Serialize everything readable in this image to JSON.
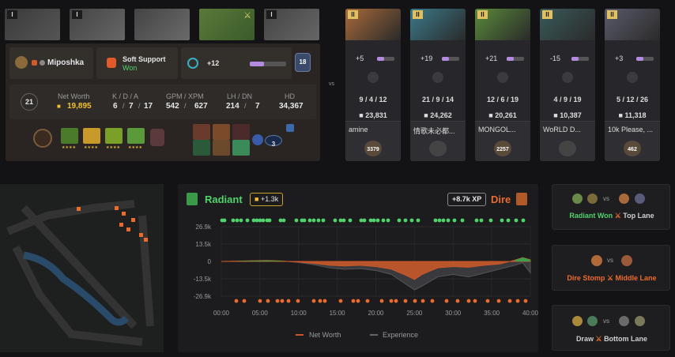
{
  "top_heroes": [
    {
      "level": "I",
      "color": "#4a4a4a"
    },
    {
      "level": "I",
      "color": "#505050"
    },
    {
      "level": "",
      "color": "#555555"
    },
    {
      "level": "",
      "color": "#6a8a3a",
      "selected": true
    },
    {
      "level": "I",
      "color": "#4a4a4a"
    }
  ],
  "player": {
    "name": "Miposhka",
    "role": "Soft Support",
    "result": "Won",
    "xp_change": "+12",
    "rank_badge": "18",
    "level": "21",
    "net_worth_label": "Net Worth",
    "net_worth": "19,895",
    "kda_label": "K / D / A",
    "kills": "6",
    "deaths": "7",
    "assists": "17",
    "gpm_xpm_label": "GPM / XPM",
    "gpm": "542",
    "xpm": "627",
    "lh_dn_label": "LH / DN",
    "lh": "214",
    "dn": "7",
    "hd_label": "HD",
    "hd": "34,367",
    "backpack_count": "3"
  },
  "vs_label": "vs",
  "opponents": [
    {
      "level": "II",
      "change": "+5",
      "k": "9",
      "d": "4",
      "a": "12",
      "net_worth": "23,831",
      "name": "amine",
      "rank": "3379",
      "color": "#a86a3a"
    },
    {
      "level": "II",
      "change": "+19",
      "k": "21",
      "d": "9",
      "a": "14",
      "net_worth": "24,262",
      "name": "情歌未必都...",
      "rank": "",
      "color": "#3a7a8a"
    },
    {
      "level": "II",
      "change": "+21",
      "k": "12",
      "d": "6",
      "a": "19",
      "net_worth": "20,261",
      "name": "MONGOL...",
      "rank": "2257",
      "color": "#5a8a3a"
    },
    {
      "level": "II",
      "change": "-15",
      "k": "4",
      "d": "9",
      "a": "19",
      "net_worth": "10,387",
      "name": "WoRLD D...",
      "rank": "",
      "color": "#3a5a5a"
    },
    {
      "level": "II",
      "change": "+3",
      "k": "5",
      "d": "12",
      "a": "26",
      "net_worth": "11,318",
      "name": "10k Please, ...",
      "rank": "462",
      "color": "#5a5a6a"
    }
  ],
  "graph": {
    "radiant_label": "Radiant",
    "radiant_badge": "+1.3k",
    "dire_label": "Dire",
    "dire_badge": "+8.7k XP",
    "y_ticks": [
      "26.9k",
      "13.5k",
      "0",
      "-13.5k",
      "-26.9k"
    ],
    "x_ticks": [
      "00:00",
      "05:00",
      "10:00",
      "15:00",
      "20:00",
      "25:00",
      "30:00",
      "35:00",
      "40:00"
    ],
    "legend_net_worth": "Net Worth",
    "legend_experience": "Experience",
    "colors": {
      "radiant": "#4fd36a",
      "dire": "#ec6b2c",
      "net_worth": "#c8582a",
      "experience": "#555555"
    }
  },
  "chart_data": {
    "type": "area",
    "x": [
      0,
      2,
      4,
      6,
      8,
      10,
      12,
      14,
      16,
      18,
      20,
      22,
      24,
      25,
      26,
      28,
      30,
      32,
      34,
      36,
      38,
      39,
      40
    ],
    "series": [
      {
        "name": "Net Worth",
        "values": [
          0,
          200,
          500,
          800,
          300,
          -500,
          -1500,
          -3000,
          -3500,
          -3000,
          -4000,
          -6000,
          -11000,
          -14000,
          -10000,
          -5000,
          -4000,
          -4500,
          -3000,
          -2000,
          1000,
          3000,
          1300
        ]
      },
      {
        "name": "Experience",
        "values": [
          0,
          100,
          300,
          500,
          200,
          -800,
          -2500,
          -5000,
          -6000,
          -5500,
          -7000,
          -10000,
          -18000,
          -22000,
          -19000,
          -12000,
          -10000,
          -12000,
          -9000,
          -6000,
          -3000,
          -1000,
          -8700
        ]
      }
    ],
    "ylim": [
      -26.9,
      26.9
    ],
    "xlabel": "",
    "ylabel": ""
  },
  "sides": [
    {
      "text_left": "Radiant Won",
      "text_right": "Top Lane",
      "color": "#4fd36a",
      "vs": "vs"
    },
    {
      "text_left": "Dire Stomp",
      "text_right": "Middle Lane",
      "color": "#ec6b2c",
      "vs": "vs"
    },
    {
      "text_left": "Draw",
      "text_right": "Bottom Lane",
      "color": "#cfcfcf",
      "vs": "vs"
    }
  ]
}
